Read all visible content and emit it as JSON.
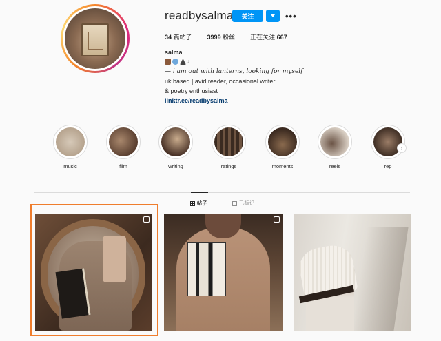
{
  "profile": {
    "username": "readbysalma",
    "follow_label": "关注",
    "stats": {
      "posts_count": "34",
      "posts_label": "篇帖子",
      "followers_count": "3999",
      "followers_label": "粉丝",
      "following_label": "正在关注",
      "following_count": "667"
    },
    "bio": {
      "name": "salma",
      "quote": "— i am out with lanterns, looking for myself",
      "line2": "uk based | avid reader, occasional writer",
      "line3": "& poetry enthusiast",
      "link": "linktr.ee/readbysalma"
    }
  },
  "highlights": [
    {
      "label": "music",
      "color": "#b9a793"
    },
    {
      "label": "film",
      "color": "#6b4c3b"
    },
    {
      "label": "writing",
      "color": "#5a3f31"
    },
    {
      "label": "ratings",
      "color": "#3d2e25"
    },
    {
      "label": "moments",
      "color": "#4a3628"
    },
    {
      "label": "reels",
      "color": "#9c8778"
    },
    {
      "label": "rep",
      "color": "#5c463a"
    }
  ],
  "tabs": {
    "posts_label": "帖子",
    "tagged_label": "已标记"
  },
  "colors": {
    "accent": "#0095f6",
    "link": "#00376b",
    "selection": "#ef7d2d"
  }
}
